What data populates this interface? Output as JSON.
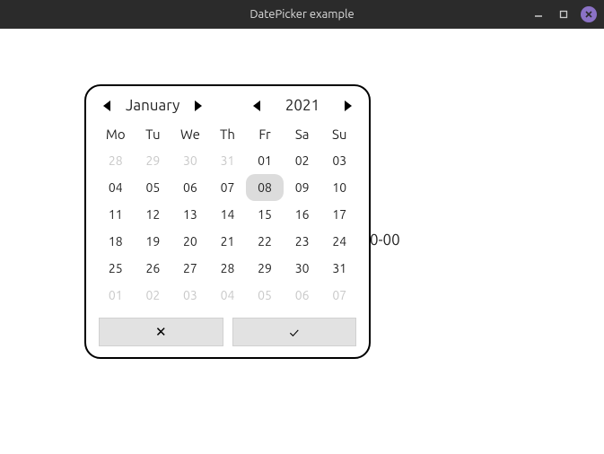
{
  "window": {
    "title": "DatePicker example"
  },
  "underlay_text": "0-00",
  "datepicker": {
    "month_label": "January",
    "year_label": "2021",
    "dow": [
      "Mo",
      "Tu",
      "We",
      "Th",
      "Fr",
      "Sa",
      "Su"
    ],
    "weeks": [
      [
        {
          "d": "28",
          "outside": true,
          "sel": false
        },
        {
          "d": "29",
          "outside": true,
          "sel": false
        },
        {
          "d": "30",
          "outside": true,
          "sel": false
        },
        {
          "d": "31",
          "outside": true,
          "sel": false
        },
        {
          "d": "01",
          "outside": false,
          "sel": false
        },
        {
          "d": "02",
          "outside": false,
          "sel": false
        },
        {
          "d": "03",
          "outside": false,
          "sel": false
        }
      ],
      [
        {
          "d": "04",
          "outside": false,
          "sel": false
        },
        {
          "d": "05",
          "outside": false,
          "sel": false
        },
        {
          "d": "06",
          "outside": false,
          "sel": false
        },
        {
          "d": "07",
          "outside": false,
          "sel": false
        },
        {
          "d": "08",
          "outside": false,
          "sel": true
        },
        {
          "d": "09",
          "outside": false,
          "sel": false
        },
        {
          "d": "10",
          "outside": false,
          "sel": false
        }
      ],
      [
        {
          "d": "11",
          "outside": false,
          "sel": false
        },
        {
          "d": "12",
          "outside": false,
          "sel": false
        },
        {
          "d": "13",
          "outside": false,
          "sel": false
        },
        {
          "d": "14",
          "outside": false,
          "sel": false
        },
        {
          "d": "15",
          "outside": false,
          "sel": false
        },
        {
          "d": "16",
          "outside": false,
          "sel": false
        },
        {
          "d": "17",
          "outside": false,
          "sel": false
        }
      ],
      [
        {
          "d": "18",
          "outside": false,
          "sel": false
        },
        {
          "d": "19",
          "outside": false,
          "sel": false
        },
        {
          "d": "20",
          "outside": false,
          "sel": false
        },
        {
          "d": "21",
          "outside": false,
          "sel": false
        },
        {
          "d": "22",
          "outside": false,
          "sel": false
        },
        {
          "d": "23",
          "outside": false,
          "sel": false
        },
        {
          "d": "24",
          "outside": false,
          "sel": false
        }
      ],
      [
        {
          "d": "25",
          "outside": false,
          "sel": false
        },
        {
          "d": "26",
          "outside": false,
          "sel": false
        },
        {
          "d": "27",
          "outside": false,
          "sel": false
        },
        {
          "d": "28",
          "outside": false,
          "sel": false
        },
        {
          "d": "29",
          "outside": false,
          "sel": false
        },
        {
          "d": "30",
          "outside": false,
          "sel": false
        },
        {
          "d": "31",
          "outside": false,
          "sel": false
        }
      ],
      [
        {
          "d": "01",
          "outside": true,
          "sel": false
        },
        {
          "d": "02",
          "outside": true,
          "sel": false
        },
        {
          "d": "03",
          "outside": true,
          "sel": false
        },
        {
          "d": "04",
          "outside": true,
          "sel": false
        },
        {
          "d": "05",
          "outside": true,
          "sel": false
        },
        {
          "d": "06",
          "outside": true,
          "sel": false
        },
        {
          "d": "07",
          "outside": true,
          "sel": false
        }
      ]
    ],
    "cancel_label": "✕",
    "confirm_label": "✓"
  }
}
